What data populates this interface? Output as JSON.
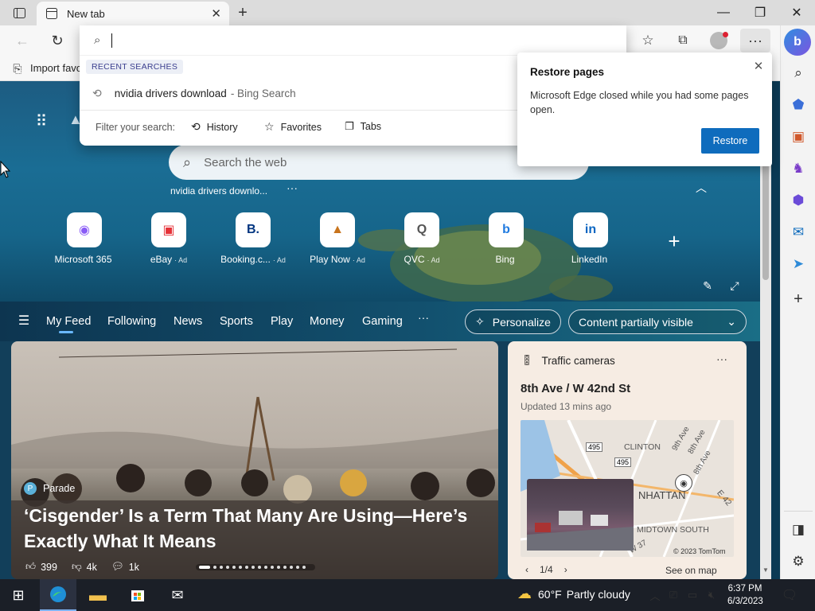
{
  "browser": {
    "tab_title": "New tab",
    "favorites_bar": {
      "import_label": "Import favo"
    },
    "address": {
      "value": ""
    }
  },
  "dropdown": {
    "section_title": "RECENT SEARCHES",
    "recent": [
      {
        "query": "nvidia drivers download",
        "source": "- Bing Search"
      }
    ],
    "filter_label": "Filter your search:",
    "filters": [
      "History",
      "Favorites",
      "Tabs"
    ]
  },
  "restore_popup": {
    "title": "Restore pages",
    "body": "Microsoft Edge closed while you had some pages open.",
    "button": "Restore"
  },
  "newtab": {
    "search_placeholder": "Search the web",
    "recent_chip": "nvidia drivers downlo...",
    "tiles": [
      {
        "label": "Microsoft 365",
        "ad": "",
        "glyph": "◉",
        "color": "#8a5cf6"
      },
      {
        "label": "eBay",
        "ad": "· Ad",
        "glyph": "▣",
        "color": "#e53238"
      },
      {
        "label": "Booking.c...",
        "ad": "· Ad",
        "glyph": "B.",
        "color": "#003580"
      },
      {
        "label": "Play Now",
        "ad": "· Ad",
        "glyph": "▲",
        "color": "#c8741d"
      },
      {
        "label": "QVC",
        "ad": "· Ad",
        "glyph": "Q",
        "color": "#555555"
      },
      {
        "label": "Bing",
        "ad": "",
        "glyph": "b",
        "color": "#1f7ae0"
      },
      {
        "label": "LinkedIn",
        "ad": "",
        "glyph": "in",
        "color": "#0a66c2"
      }
    ]
  },
  "feed": {
    "nav": [
      "My Feed",
      "Following",
      "News",
      "Sports",
      "Play",
      "Money",
      "Gaming"
    ],
    "personalize": "Personalize",
    "content_filter": "Content partially visible",
    "hero_story": {
      "source": "Parade",
      "headline": "‘Cisgender’ Is a Term That Many Are Using—Here’s Exactly What It Means",
      "likes": "399",
      "dislikes": "4k",
      "comments": "1k"
    },
    "traffic": {
      "title": "Traffic cameras",
      "location": "8th Ave / W 42nd St",
      "updated": "Updated 13 mins ago",
      "map_labels": [
        "CLINTON",
        "9th Ave",
        "8th Ave",
        "8th Ave",
        "495",
        "495",
        "NHATTAN",
        "E 42",
        "MIDTOWN SOUTH",
        "W 37"
      ],
      "copyright": "© 2023 TomTom",
      "pager": "1/4",
      "see_on_map": "See on map"
    }
  },
  "taskbar": {
    "weather_temp": "60°F",
    "weather_text": "Partly cloudy",
    "time": "6:37 PM",
    "date": "6/3/2023"
  }
}
